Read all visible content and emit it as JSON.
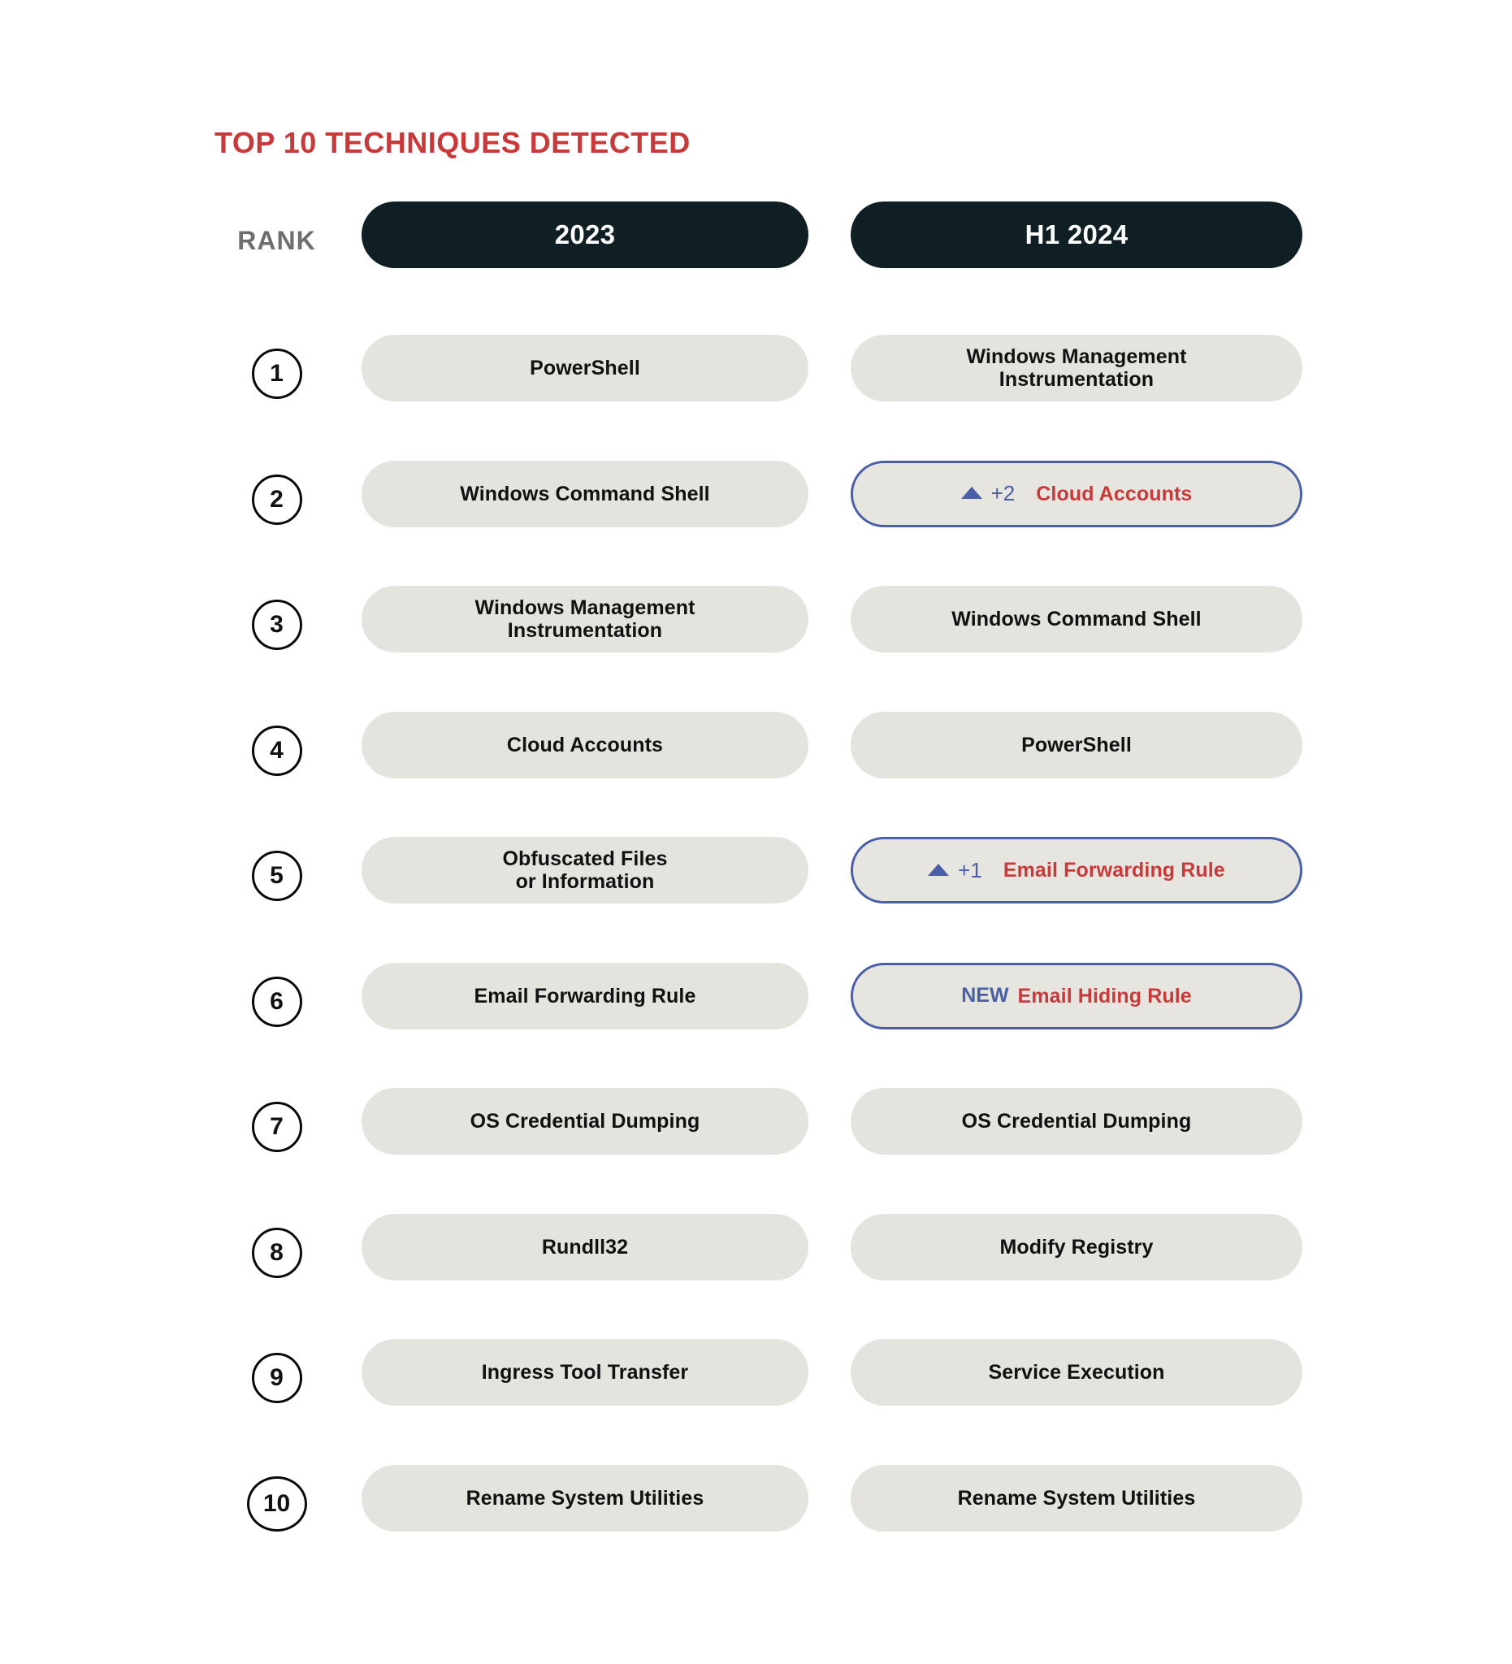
{
  "title": "TOP 10 TECHNIQUES DETECTED",
  "colors": {
    "accent_red": "#C9393A",
    "header_pill": "#101F24",
    "pill_gray": "#E5E3DE",
    "highlight_blue": "#4A5FA5",
    "rank_label_gray": "#6E6E6E"
  },
  "header": {
    "rank_label": "RANK",
    "columns": [
      {
        "label": "2023"
      },
      {
        "label": "H1 2024"
      }
    ]
  },
  "rows": [
    {
      "rank": "1",
      "y2023": {
        "lines": [
          "PowerShell"
        ],
        "highlight": false
      },
      "h1_2024": {
        "lines": [
          "Windows Management",
          "Instrumentation"
        ],
        "highlight": false
      }
    },
    {
      "rank": "2",
      "y2023": {
        "lines": [
          "Windows Command Shell"
        ],
        "highlight": false
      },
      "h1_2024": {
        "lines": [
          "Cloud Accounts"
        ],
        "highlight": true,
        "badge": {
          "type": "up-arrow",
          "icon": "triangle-up-icon",
          "delta": "+2"
        }
      }
    },
    {
      "rank": "3",
      "y2023": {
        "lines": [
          "Windows Management",
          "Instrumentation"
        ],
        "highlight": false
      },
      "h1_2024": {
        "lines": [
          "Windows Command Shell"
        ],
        "highlight": false
      }
    },
    {
      "rank": "4",
      "y2023": {
        "lines": [
          "Cloud Accounts"
        ],
        "highlight": false
      },
      "h1_2024": {
        "lines": [
          "PowerShell"
        ],
        "highlight": false
      }
    },
    {
      "rank": "5",
      "y2023": {
        "lines": [
          "Obfuscated Files",
          "or Information"
        ],
        "highlight": false
      },
      "h1_2024": {
        "lines": [
          "Email Forwarding Rule"
        ],
        "highlight": true,
        "badge": {
          "type": "up-arrow",
          "icon": "triangle-up-icon",
          "delta": "+1"
        }
      }
    },
    {
      "rank": "6",
      "y2023": {
        "lines": [
          "Email Forwarding Rule"
        ],
        "highlight": false
      },
      "h1_2024": {
        "lines": [
          "Email Hiding Rule"
        ],
        "highlight": true,
        "badge": {
          "type": "new",
          "label": "NEW"
        }
      }
    },
    {
      "rank": "7",
      "y2023": {
        "lines": [
          "OS Credential Dumping"
        ],
        "highlight": false
      },
      "h1_2024": {
        "lines": [
          "OS Credential Dumping"
        ],
        "highlight": false
      }
    },
    {
      "rank": "8",
      "y2023": {
        "lines": [
          "Rundll32"
        ],
        "highlight": false
      },
      "h1_2024": {
        "lines": [
          "Modify Registry"
        ],
        "highlight": false
      }
    },
    {
      "rank": "9",
      "y2023": {
        "lines": [
          "Ingress Tool Transfer"
        ],
        "highlight": false
      },
      "h1_2024": {
        "lines": [
          "Service Execution"
        ],
        "highlight": false
      }
    },
    {
      "rank": "10",
      "y2023": {
        "lines": [
          "Rename System Utilities"
        ],
        "highlight": false
      },
      "h1_2024": {
        "lines": [
          "Rename System Utilities"
        ],
        "highlight": false
      }
    }
  ]
}
